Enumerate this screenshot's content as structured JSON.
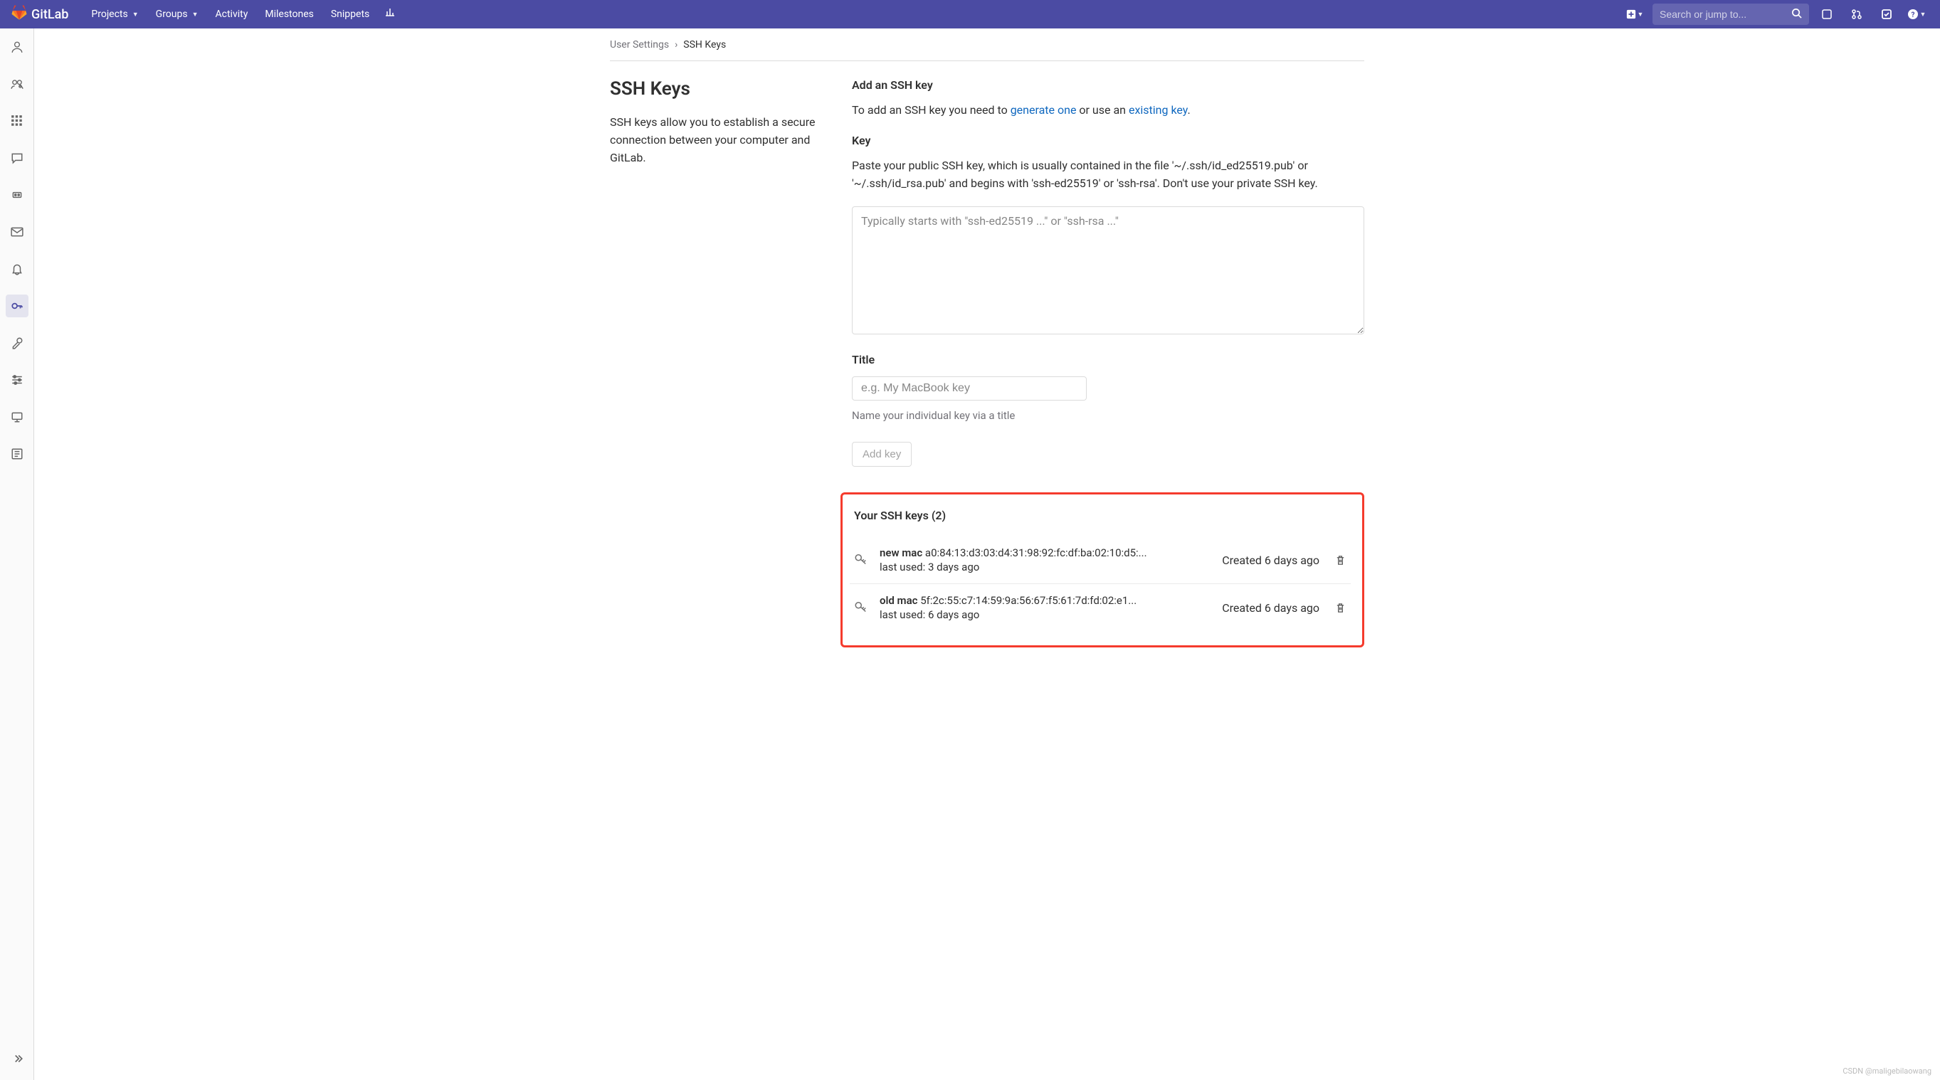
{
  "brand": "GitLab",
  "nav": {
    "projects": "Projects",
    "groups": "Groups",
    "activity": "Activity",
    "milestones": "Milestones",
    "snippets": "Snippets"
  },
  "search": {
    "placeholder": "Search or jump to..."
  },
  "breadcrumb": {
    "parent": "User Settings",
    "current": "SSH Keys"
  },
  "left": {
    "title": "SSH Keys",
    "desc": "SSH keys allow you to establish a secure connection between your computer and GitLab."
  },
  "form": {
    "add_heading": "Add an SSH key",
    "add_help_prefix": "To add an SSH key you need to ",
    "generate_link": "generate one",
    "add_help_mid": " or use an ",
    "existing_link": "existing key",
    "add_help_suffix": ".",
    "key_label": "Key",
    "key_help": "Paste your public SSH key, which is usually contained in the file '~/.ssh/id_ed25519.pub' or '~/.ssh/id_rsa.pub' and begins with 'ssh-ed25519' or 'ssh-rsa'. Don't use your private SSH key.",
    "key_placeholder": "Typically starts with \"ssh-ed25519 ...\" or \"ssh-rsa ...\"",
    "title_label": "Title",
    "title_placeholder": "e.g. My MacBook key",
    "title_hint": "Name your individual key via a title",
    "add_btn": "Add key"
  },
  "keys": {
    "heading": "Your SSH keys (2)",
    "rows": [
      {
        "name": "new mac",
        "fingerprint": "a0:84:13:d3:03:d4:31:98:92:fc:df:ba:02:10:d5:...",
        "lastused": "last used: 3 days ago",
        "created": "Created 6 days ago"
      },
      {
        "name": "old mac",
        "fingerprint": "5f:2c:55:c7:14:59:9a:56:67:f5:61:7d:fd:02:e1...",
        "lastused": "last used: 6 days ago",
        "created": "Created 6 days ago"
      }
    ]
  },
  "watermark": "CSDN @maligebilaowang"
}
